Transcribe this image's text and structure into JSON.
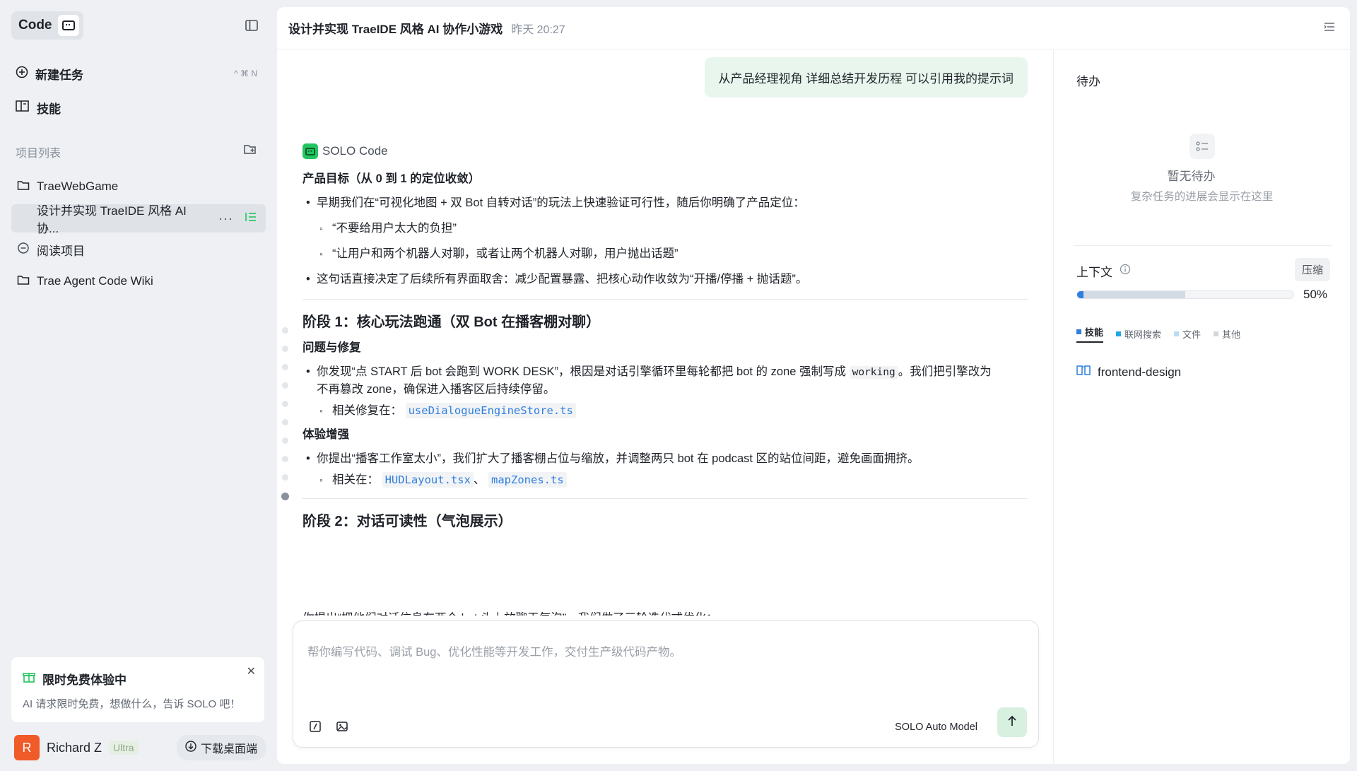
{
  "sidebar": {
    "brand": "Code",
    "nav": {
      "new_task": "新建任务",
      "new_task_shortcut": "^ ⌘ N",
      "skills": "技能"
    },
    "projects_label": "项目列表",
    "projects": [
      {
        "label": "TraeWebGame"
      },
      {
        "label": "设计并实现 TraeIDE 风格 AI 协..."
      },
      {
        "label": "阅读项目"
      },
      {
        "label": "Trae Agent Code Wiki"
      }
    ],
    "promo": {
      "title": "限时免费体验中",
      "body": "AI 请求限时免费，想做什么，告诉 SOLO 吧！"
    },
    "user": {
      "initial": "R",
      "name": "Richard Z",
      "plan": "Ultra",
      "download_label": "下载桌面端"
    }
  },
  "header": {
    "title": "设计并实现 TraeIDE 风格 AI 协作小游戏",
    "time": "昨天 20:27"
  },
  "chat": {
    "user_message": "从产品经理视角 详细总结开发历程 可以引用我的提示词",
    "sender": "SOLO Code",
    "sec1_title": "产品目标（从 0 到 1 的定位收敛）",
    "sec1_b1": "早期我们在“可视化地图 + 双 Bot 自转对话”的玩法上快速验证可行性，随后你明确了产品定位：",
    "sec1_b1_s1": "“不要给用户太大的负担”",
    "sec1_b1_s2": "“让用户和两个机器人对聊，或者让两个机器人对聊，用户抛出话题”",
    "sec1_b2": "这句话直接决定了后续所有界面取舍：减少配置暴露、把核心动作收敛为“开播/停播 + 抛话题”。",
    "phase1_title": "阶段 1：核心玩法跑通（双 Bot 在播客棚对聊）",
    "phase1_sub1": "问题与修复",
    "phase1_b1_pre": "你发现“点 START 后 bot 会跑到 WORK DESK”，根因是对话引擎循环里每轮都把 bot 的 zone 强制写成 ",
    "phase1_b1_code": "working",
    "phase1_b1_post": "。我们把引擎改为",
    "phase1_b1_line2": "不再篡改 zone，确保进入播客区后持续停留。",
    "phase1_b1_s1_label": "相关修复在：",
    "phase1_b1_s1_file": "useDialogueEngineStore.ts",
    "phase1_sub2": "体验增强",
    "phase1_b2": "你提出“播客工作室太小”，我们扩大了播客棚占位与缩放，并调整两只 bot 在 podcast 区的站位间距，避免画面拥挤。",
    "phase1_b2_s1_label": "相关在：",
    "phase1_b2_s1_file1": "HUDLayout.tsx",
    "phase1_b2_s1_sep": "、",
    "phase1_b2_s1_file2": "mapZones.ts",
    "phase2_title": "阶段 2：对话可读性（气泡展示）",
    "phase2_cut": "你提出“把他们对话信息在两个 bot 头上放聊天气泡”，我们做了三轮迭代式优化："
  },
  "composer": {
    "placeholder": "帮你编写代码、调试 Bug、优化性能等开发工作，交付生产级代码产物。",
    "model": "SOLO Auto Model"
  },
  "right_panel": {
    "todo_title": "待办",
    "todo_empty_title": "暂无待办",
    "todo_empty_sub": "复杂任务的进展会显示在这里",
    "context_title": "上下文",
    "compress_label": "压缩",
    "context_percent": "50%",
    "context_fraction": 0.5,
    "legend": [
      {
        "label": "技能",
        "color": "#2f7fe0"
      },
      {
        "label": "联网搜索",
        "color": "#1ea7e4"
      },
      {
        "label": "文件",
        "color": "#b9dcf5"
      },
      {
        "label": "其他",
        "color": "#d3d6db"
      }
    ],
    "skill_item": "frontend-design"
  },
  "colors": {
    "accent_green": "#22c55e",
    "link_blue": "#2f7fe0",
    "user_bubble": "#e8f6ed"
  }
}
